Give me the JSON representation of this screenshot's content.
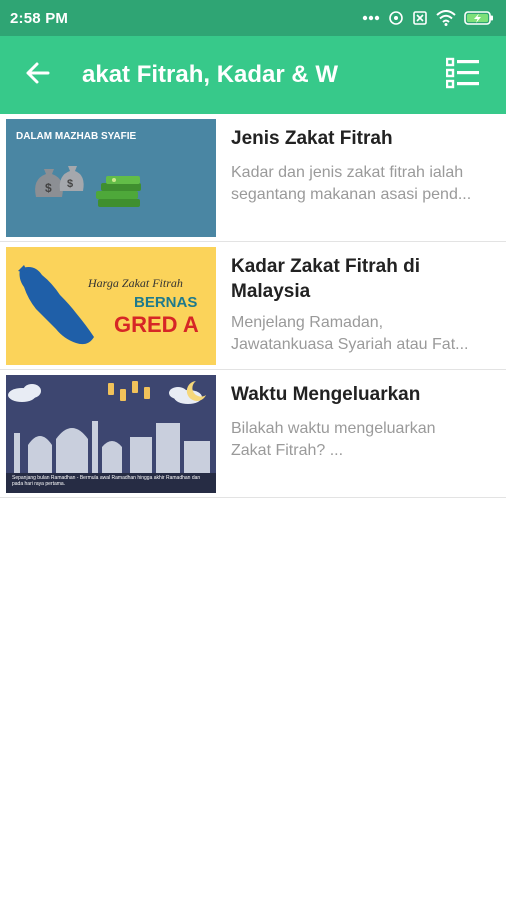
{
  "status_bar": {
    "time": "2:58 PM",
    "icons": [
      "dots-icon",
      "location-icon",
      "no-sim-icon",
      "wifi-icon",
      "battery-charging-icon"
    ]
  },
  "app_bar": {
    "title": "akat Fitrah, Kadar & W",
    "back_icon": "arrow-left-icon",
    "menu_icon": "list-view-icon"
  },
  "articles": [
    {
      "title": "Jenis Zakat Fitrah",
      "desc_line1": "Kadar dan jenis zakat fitrah ialah",
      "desc_line2": "segantang makanan asasi pend...",
      "thumb_caption": "DALAM MAZHAB SYAFIE",
      "thumb_bg": "#4a86a3"
    },
    {
      "title": "Kadar Zakat Fitrah di Malaysia",
      "desc_line1": "Menjelang Ramadan,",
      "desc_line2": "Jawatankuasa Syariah atau Fat...",
      "thumb_caption1": "Harga Zakat Fitrah",
      "thumb_caption2": "BERNAS",
      "thumb_caption3": "GRED A",
      "thumb_bg": "#fbd35a"
    },
    {
      "title": "Waktu Mengeluarkan",
      "desc_line1": "Bilakah waktu mengeluarkan",
      "desc_line2": "Zakat Fitrah? ...",
      "thumb_caption": "Sepanjang bulan Ramadhan - Bermula awal Ramadhan hingga akhir Ramadhan dan pada hari raya pertama.",
      "thumb_bg": "#3d4670"
    }
  ]
}
